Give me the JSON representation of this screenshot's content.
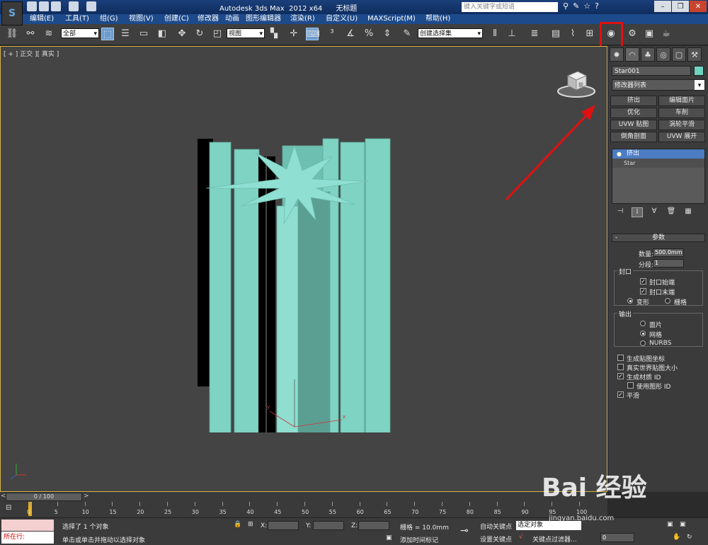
{
  "titlebar": {
    "title": "Autodesk 3ds Max  2012 x64      无标题",
    "search_placeholder": "键入关键字或短语"
  },
  "menu": [
    {
      "label": "编辑(E)"
    },
    {
      "label": "工具(T)"
    },
    {
      "label": "组(G)"
    },
    {
      "label": "视图(V)"
    },
    {
      "label": "创建(C)"
    },
    {
      "label": "修改器"
    },
    {
      "label": "动画"
    },
    {
      "label": "图形编辑器"
    },
    {
      "label": "渲染(R)"
    },
    {
      "label": "自定义(U)"
    },
    {
      "label": "MAXScript(M)"
    },
    {
      "label": "帮助(H)"
    }
  ],
  "toolbar": {
    "selection_filter": "全部",
    "reference_coord": "视图",
    "named_selection": "创建选择集"
  },
  "viewport": {
    "label": "[ + ] 正交 ][ 真实 ]",
    "viewcube_label": "前"
  },
  "command_panel": {
    "object_name": "Star001",
    "object_color": "#6fd4c0",
    "modifier_list": "修改器列表",
    "modifier_buttons": [
      "挤出",
      "编辑面片",
      "优化",
      "车削",
      "UVW 贴图",
      "涡轮平滑",
      "倒角剖面",
      "UVW 展开"
    ],
    "stack": {
      "active": "挤出",
      "base": "Star"
    },
    "rollout_title": "参数",
    "amount_label": "数量:",
    "amount_value": "500.0mm",
    "segments_label": "分段:",
    "segments_value": "1",
    "capping_title": "封口",
    "cap_start": "封口始端",
    "cap_end": "封口末端",
    "morph": "变形",
    "grid": "栅格",
    "output_title": "输出",
    "patch": "面片",
    "mesh": "网格",
    "nurbs": "NURBS",
    "gen_mapping": "生成贴图坐标",
    "real_world": "真实世界贴图大小",
    "gen_matid": "生成材质 ID",
    "use_shape_ids": "使用图形 ID",
    "smooth": "平滑"
  },
  "timeline": {
    "frame_display": "0 / 100",
    "ticks": [
      "0",
      "5",
      "10",
      "15",
      "20",
      "25",
      "30",
      "35",
      "40",
      "45",
      "50",
      "55",
      "60",
      "65",
      "70",
      "75",
      "80",
      "85",
      "90",
      "95",
      "100"
    ]
  },
  "status": {
    "script_prompt": "所在行:",
    "selected": "选择了 1 个对象",
    "hint": "单击或单击并拖动以选择对象",
    "x_label": "X:",
    "y_label": "Y:",
    "z_label": "Z:",
    "grid": "栅格 = 10.0mm",
    "add_time_tag": "添加时间标记",
    "auto_key": "自动关键点",
    "set_key": "设置关键点",
    "key_mode": "选定对象",
    "key_filters": "关键点过滤器...",
    "frame": "0"
  },
  "watermark": {
    "brand": "Bai 经验",
    "url": "jingyan.baidu.com"
  }
}
